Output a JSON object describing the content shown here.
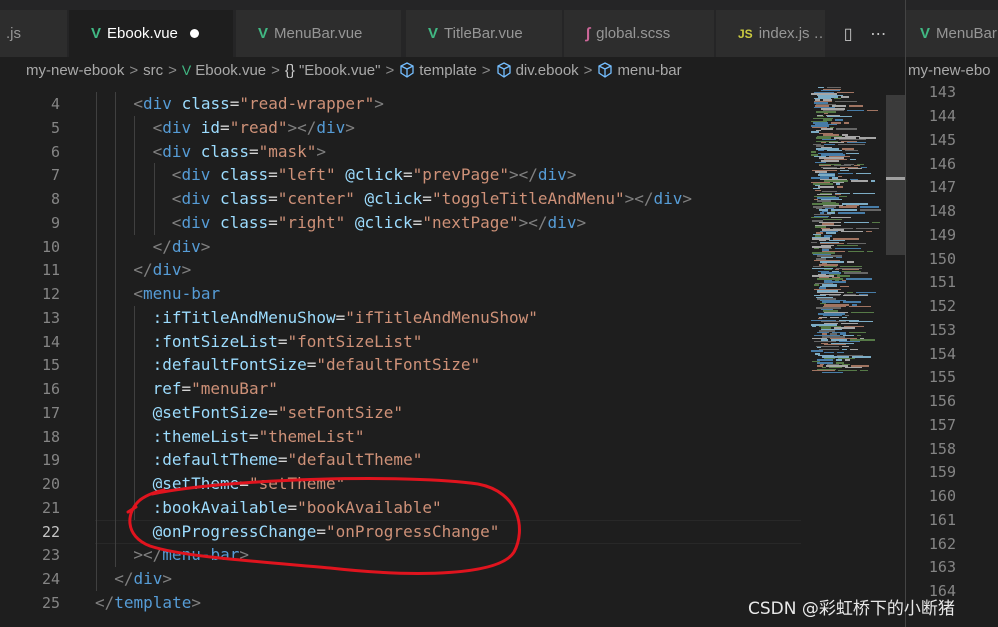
{
  "tabs": [
    {
      "label": ".js",
      "icon": "js-file-icon",
      "active": false
    },
    {
      "label": "Ebook.vue",
      "icon": "vue-file-icon",
      "active": true,
      "modified": true
    },
    {
      "label": "MenuBar.vue",
      "icon": "vue-file-icon",
      "active": false
    },
    {
      "label": "TitleBar.vue",
      "icon": "vue-file-icon",
      "active": false
    },
    {
      "label": "global.scss",
      "icon": "scss-file-icon",
      "active": false
    },
    {
      "label": "index.js",
      "icon": "js-file-icon",
      "active": false,
      "suffix": "…"
    }
  ],
  "tab_icons": {
    "js": "JS",
    "vue": "V",
    "scss": "∫"
  },
  "tab_actions": {
    "split_icon": "▯",
    "more_icon": "⋯"
  },
  "breadcrumb": {
    "project": "my-new-ebook",
    "folder": "src",
    "file": "Ebook.vue",
    "component": "\"Ebook.vue\"",
    "template": "template",
    "div": "div.ebook",
    "menubar": "menu-bar",
    "separator": ">",
    "brace_icon": "{}"
  },
  "editor": {
    "current_line": 22,
    "lines": [
      {
        "n": 4,
        "indent": 2,
        "tokens": [
          [
            "punc",
            "<"
          ],
          [
            "tag",
            "div"
          ],
          [
            "eq",
            " "
          ],
          [
            "attr",
            "class"
          ],
          [
            "eq",
            "="
          ],
          [
            "str",
            "\"read-wrapper\""
          ],
          [
            "punc",
            ">"
          ]
        ]
      },
      {
        "n": 5,
        "indent": 3,
        "tokens": [
          [
            "punc",
            "<"
          ],
          [
            "tag",
            "div"
          ],
          [
            "eq",
            " "
          ],
          [
            "attr",
            "id"
          ],
          [
            "eq",
            "="
          ],
          [
            "str",
            "\"read\""
          ],
          [
            "punc",
            "></"
          ],
          [
            "tag",
            "div"
          ],
          [
            "punc",
            ">"
          ]
        ]
      },
      {
        "n": 6,
        "indent": 3,
        "tokens": [
          [
            "punc",
            "<"
          ],
          [
            "tag",
            "div"
          ],
          [
            "eq",
            " "
          ],
          [
            "attr",
            "class"
          ],
          [
            "eq",
            "="
          ],
          [
            "str",
            "\"mask\""
          ],
          [
            "punc",
            ">"
          ]
        ]
      },
      {
        "n": 7,
        "indent": 4,
        "tokens": [
          [
            "punc",
            "<"
          ],
          [
            "tag",
            "div"
          ],
          [
            "eq",
            " "
          ],
          [
            "attr",
            "class"
          ],
          [
            "eq",
            "="
          ],
          [
            "str",
            "\"left\""
          ],
          [
            "eq",
            " "
          ],
          [
            "attr",
            "@click"
          ],
          [
            "eq",
            "="
          ],
          [
            "str",
            "\"prevPage\""
          ],
          [
            "punc",
            "></"
          ],
          [
            "tag",
            "div"
          ],
          [
            "punc",
            ">"
          ]
        ]
      },
      {
        "n": 8,
        "indent": 4,
        "tokens": [
          [
            "punc",
            "<"
          ],
          [
            "tag",
            "div"
          ],
          [
            "eq",
            " "
          ],
          [
            "attr",
            "class"
          ],
          [
            "eq",
            "="
          ],
          [
            "str",
            "\"center\""
          ],
          [
            "eq",
            " "
          ],
          [
            "attr",
            "@click"
          ],
          [
            "eq",
            "="
          ],
          [
            "str",
            "\"toggleTitleAndMenu\""
          ],
          [
            "punc",
            "></"
          ],
          [
            "tag",
            "div"
          ],
          [
            "punc",
            ">"
          ]
        ]
      },
      {
        "n": 9,
        "indent": 4,
        "tokens": [
          [
            "punc",
            "<"
          ],
          [
            "tag",
            "div"
          ],
          [
            "eq",
            " "
          ],
          [
            "attr",
            "class"
          ],
          [
            "eq",
            "="
          ],
          [
            "str",
            "\"right\""
          ],
          [
            "eq",
            " "
          ],
          [
            "attr",
            "@click"
          ],
          [
            "eq",
            "="
          ],
          [
            "str",
            "\"nextPage\""
          ],
          [
            "punc",
            "></"
          ],
          [
            "tag",
            "div"
          ],
          [
            "punc",
            ">"
          ]
        ]
      },
      {
        "n": 10,
        "indent": 3,
        "tokens": [
          [
            "punc",
            "</"
          ],
          [
            "tag",
            "div"
          ],
          [
            "punc",
            ">"
          ]
        ]
      },
      {
        "n": 11,
        "indent": 2,
        "tokens": [
          [
            "punc",
            "</"
          ],
          [
            "tag",
            "div"
          ],
          [
            "punc",
            ">"
          ]
        ]
      },
      {
        "n": 12,
        "indent": 2,
        "tokens": [
          [
            "punc",
            "<"
          ],
          [
            "tag",
            "menu-bar"
          ]
        ]
      },
      {
        "n": 13,
        "indent": 3,
        "tokens": [
          [
            "attr",
            ":ifTitleAndMenuShow"
          ],
          [
            "eq",
            "="
          ],
          [
            "str",
            "\"ifTitleAndMenuShow\""
          ]
        ]
      },
      {
        "n": 14,
        "indent": 3,
        "tokens": [
          [
            "attr",
            ":fontSizeList"
          ],
          [
            "eq",
            "="
          ],
          [
            "str",
            "\"fontSizeList\""
          ]
        ]
      },
      {
        "n": 15,
        "indent": 3,
        "tokens": [
          [
            "attr",
            ":defaultFontSize"
          ],
          [
            "eq",
            "="
          ],
          [
            "str",
            "\"defaultFontSize\""
          ]
        ]
      },
      {
        "n": 16,
        "indent": 3,
        "tokens": [
          [
            "attr",
            "ref"
          ],
          [
            "eq",
            "="
          ],
          [
            "str",
            "\"menuBar\""
          ]
        ]
      },
      {
        "n": 17,
        "indent": 3,
        "tokens": [
          [
            "attr",
            "@setFontSize"
          ],
          [
            "eq",
            "="
          ],
          [
            "str",
            "\"setFontSize\""
          ]
        ]
      },
      {
        "n": 18,
        "indent": 3,
        "tokens": [
          [
            "attr",
            ":themeList"
          ],
          [
            "eq",
            "="
          ],
          [
            "str",
            "\"themeList\""
          ]
        ]
      },
      {
        "n": 19,
        "indent": 3,
        "tokens": [
          [
            "attr",
            ":defaultTheme"
          ],
          [
            "eq",
            "="
          ],
          [
            "str",
            "\"defaultTheme\""
          ]
        ]
      },
      {
        "n": 20,
        "indent": 3,
        "tokens": [
          [
            "attr",
            "@setTheme"
          ],
          [
            "eq",
            "="
          ],
          [
            "str",
            "\"setTheme\""
          ]
        ]
      },
      {
        "n": 21,
        "indent": 3,
        "tokens": [
          [
            "attr",
            ":bookAvailable"
          ],
          [
            "eq",
            "="
          ],
          [
            "str",
            "\"bookAvailable\""
          ]
        ]
      },
      {
        "n": 22,
        "indent": 3,
        "tokens": [
          [
            "attr",
            "@onProgressChange"
          ],
          [
            "eq",
            "="
          ],
          [
            "str",
            "\"onProgressChange\""
          ]
        ]
      },
      {
        "n": 23,
        "indent": 2,
        "tokens": [
          [
            "punc",
            "></"
          ],
          [
            "tag",
            "menu-bar"
          ],
          [
            "punc",
            ">"
          ]
        ]
      },
      {
        "n": 24,
        "indent": 1,
        "tokens": [
          [
            "punc",
            "</"
          ],
          [
            "tag",
            "div"
          ],
          [
            "punc",
            ">"
          ]
        ]
      },
      {
        "n": 25,
        "indent": 0,
        "tokens": [
          [
            "punc",
            "</"
          ],
          [
            "tag",
            "template"
          ],
          [
            "punc",
            ">"
          ]
        ]
      }
    ]
  },
  "right_panel": {
    "tab_label": "MenuBar",
    "breadcrumb": "my-new-ebo",
    "line_numbers": [
      143,
      144,
      145,
      146,
      147,
      148,
      149,
      150,
      151,
      152,
      153,
      154,
      155,
      156,
      157,
      158,
      159,
      160,
      161,
      162,
      163,
      164
    ]
  },
  "watermark": "CSDN @彩虹桥下的小断猪",
  "colors": {
    "annotation": "#e0141e",
    "accent_vue": "#41b883"
  }
}
